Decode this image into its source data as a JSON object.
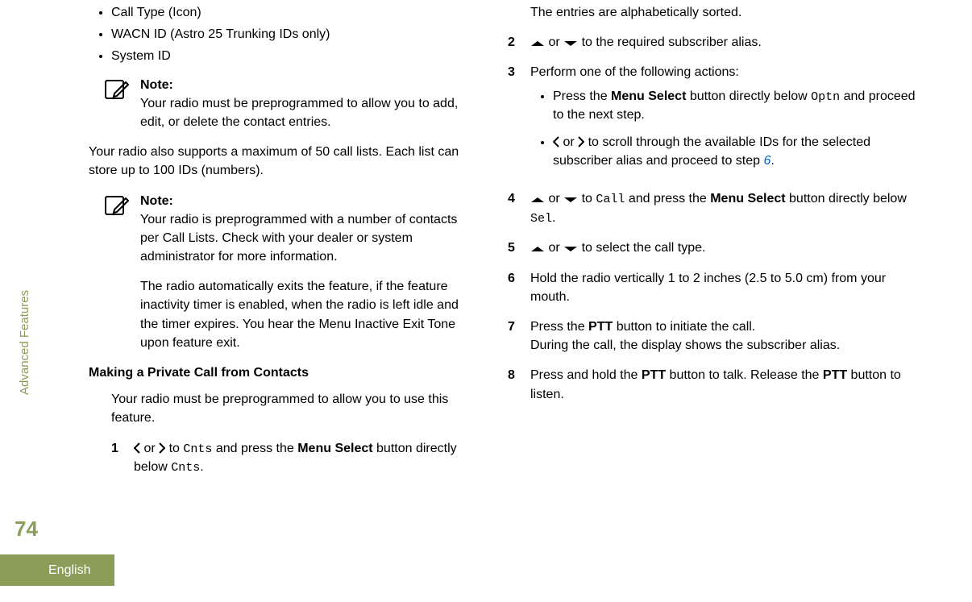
{
  "side": {
    "section": "Advanced Features",
    "pageNum": "74",
    "lang": "English"
  },
  "col1": {
    "bullets": [
      "Call Type (Icon)",
      "WACN ID (Astro 25 Trunking IDs only)",
      "System ID"
    ],
    "note1": {
      "title": "Note:",
      "body": "Your radio must be preprogrammed to allow you to add, edit, or delete the contact entries."
    },
    "para1": "Your radio also supports a maximum of 50 call lists. Each list can store up to 100 IDs (numbers).",
    "note2": {
      "title": "Note:",
      "body1": "Your radio is preprogrammed with a number of contacts per Call Lists. Check with your dealer or system administrator for more information.",
      "body2": "The radio automatically exits the feature, if the feature inactivity timer is enabled, when the radio is left idle and the timer expires. You hear the Menu Inactive Exit Tone upon feature exit."
    },
    "heading": "Making a Private Call from Contacts",
    "intro": "Your radio must be preprogrammed to allow you to use this feature.",
    "step1": {
      "num": "1",
      "or": " or ",
      "to": " to ",
      "cnts": "Cnts",
      "mid": " and press the ",
      "ms": "Menu Select",
      "tail": " button directly below ",
      "cnts2": "Cnts",
      "period": "."
    }
  },
  "col2": {
    "topline": "The entries are alphabetically sorted.",
    "step2": {
      "num": "2",
      "or": " or ",
      "tail": " to the required subscriber alias."
    },
    "step3": {
      "num": "3",
      "head": "Perform one of the following actions:",
      "a": {
        "pre": "Press the ",
        "ms": "Menu Select",
        "mid": " button directly below ",
        "optn": "Optn",
        "tail": " and proceed to the next step."
      },
      "b": {
        "or": " or ",
        "mid": " to scroll through the available IDs for the selected subscriber alias and proceed to step ",
        "link": "6",
        "period": "."
      }
    },
    "step4": {
      "num": "4",
      "or": " or ",
      "to": " to ",
      "call": "Call",
      "mid": " and press the ",
      "ms": "Menu Select",
      "mid2": " button directly below ",
      "sel": "Sel",
      "period": "."
    },
    "step5": {
      "num": "5",
      "or": " or ",
      "tail": " to select the call type."
    },
    "step6": {
      "num": "6",
      "body": "Hold the radio vertically 1 to 2 inches (2.5 to 5.0 cm) from your mouth."
    },
    "step7": {
      "num": "7",
      "pre": "Press the ",
      "ptt": "PTT",
      "mid": " button to initiate the call.",
      "line2": "During the call, the display shows the subscriber alias."
    },
    "step8": {
      "num": "8",
      "pre": "Press and hold the ",
      "ptt": "PTT",
      "mid": " button to talk. Release the ",
      "ptt2": "PTT",
      "tail": " button to listen."
    }
  }
}
